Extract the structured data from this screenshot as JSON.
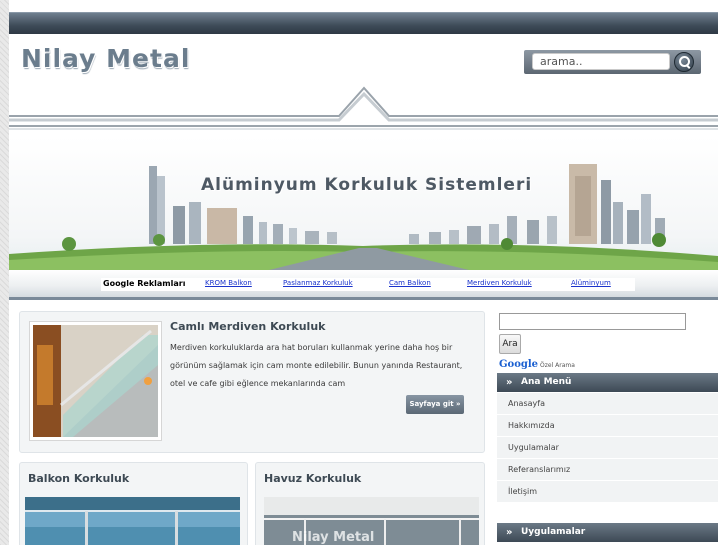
{
  "header": {
    "logo": "Nilay Metal",
    "search_placeholder": "arama.."
  },
  "banner": {
    "title": "Alüminyum Korkuluk Sistemleri"
  },
  "ads": {
    "title": "Google Reklamları",
    "links": [
      "KROM Balkon",
      "Paslanmaz Korkuluk",
      "Cam Balkon",
      "Merdiven Korkuluk",
      "Alüminyum"
    ]
  },
  "featured": {
    "title": "Camlı Merdiven Korkuluk",
    "text": "Merdiven korkuluklarda ara hat boruları kullanmak yerine daha hoş bir görünüm sağlamak için cam monte edilebilir. Bunun yanında Restaurant, otel ve cafe gibi eğlence mekanlarında cam",
    "button": "Sayfaya git »"
  },
  "cards": [
    {
      "title": "Balkon Korkuluk"
    },
    {
      "title": "Havuz Korkuluk",
      "watermark": "Nilay Metal"
    }
  ],
  "sidebar": {
    "search_button": "Ara",
    "google_label": "Google",
    "custom_search_label": "Özel Arama",
    "main_menu_title": "Ana Menü",
    "menu_items": [
      "Anasayfa",
      "Hakkımızda",
      "Uygulamalar",
      "Referanslarımız",
      "İletişim"
    ],
    "apps_title": "Uygulamalar"
  },
  "colors": {
    "accent_dark": "#3d4955",
    "logo_gray": "#6b7d8d",
    "link_blue": "#1a33cc"
  }
}
